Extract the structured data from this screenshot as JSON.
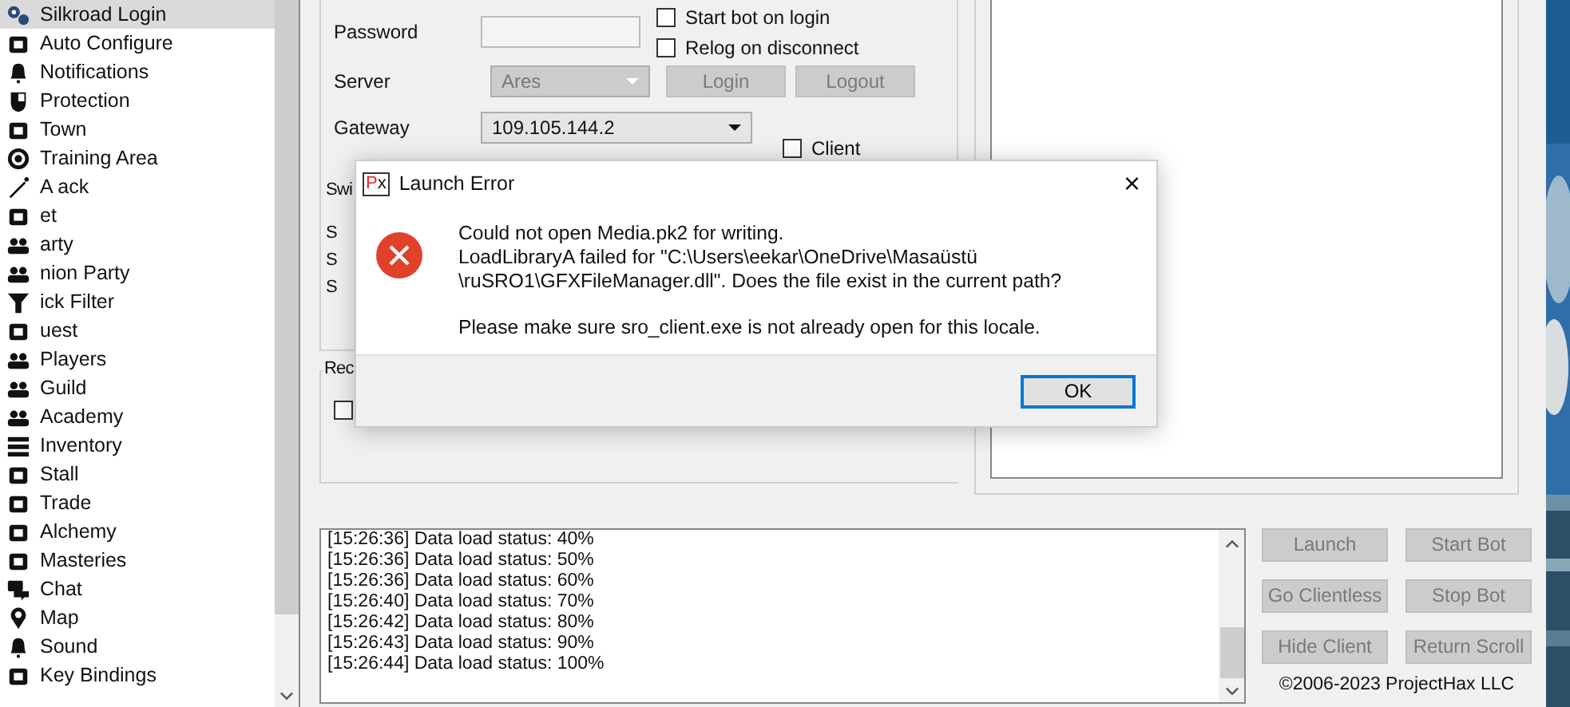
{
  "sidebar": {
    "items": [
      {
        "label": "Silkroad Login",
        "selected": true
      },
      {
        "label": "Auto Configure",
        "selected": false
      },
      {
        "label": "Notifications",
        "selected": false
      },
      {
        "label": "Protection",
        "selected": false
      },
      {
        "label": "Town",
        "selected": false
      },
      {
        "label": "Training Area",
        "selected": false
      },
      {
        "label": "A ack",
        "selected": false
      },
      {
        "label": "et",
        "selected": false
      },
      {
        "label": "arty",
        "selected": false
      },
      {
        "label": "nion Party",
        "selected": false
      },
      {
        "label": "ick Filter",
        "selected": false
      },
      {
        "label": "uest",
        "selected": false
      },
      {
        "label": "Players",
        "selected": false
      },
      {
        "label": "Guild",
        "selected": false
      },
      {
        "label": "Academy",
        "selected": false
      },
      {
        "label": "Inventory",
        "selected": false
      },
      {
        "label": "Stall",
        "selected": false
      },
      {
        "label": "Trade",
        "selected": false
      },
      {
        "label": "Alchemy",
        "selected": false
      },
      {
        "label": "Masteries",
        "selected": false
      },
      {
        "label": "Chat",
        "selected": false
      },
      {
        "label": "Map",
        "selected": false
      },
      {
        "label": "Sound",
        "selected": false
      },
      {
        "label": "Key Bindings",
        "selected": false
      }
    ]
  },
  "login": {
    "password_label": "Password",
    "server_label": "Server",
    "server": "Ares",
    "gateway_label": "Gateway",
    "gateway": "109.105.144.2",
    "checkboxes": [
      {
        "label": "Start bot on login",
        "checked": false
      },
      {
        "label": "Relog on disconnect",
        "checked": false
      }
    ],
    "buttons": [
      {
        "label": "Login",
        "disabled": true
      },
      {
        "label": "Logout",
        "disabled": true
      }
    ],
    "hidden_labels": [
      "Swi",
      "S",
      "S",
      "S"
    ],
    "client_checkbox": {
      "label": "Client",
      "checked": false
    },
    "group_label": "Rec",
    "group_checkbox": {
      "checked": false
    }
  },
  "log": [
    "[15:26:36] Data load status: 40%",
    "[15:26:36] Data load status: 50%",
    "[15:26:36] Data load status: 60%",
    "[15:26:40] Data load status: 70%",
    "[15:26:42] Data load status: 80%",
    "[15:26:43] Data load status: 90%",
    "[15:26:44] Data load status: 100%"
  ],
  "actions": [
    {
      "label": "Launch",
      "disabled": true
    },
    {
      "label": "Start Bot",
      "disabled": true
    },
    {
      "label": "Go Clientless",
      "disabled": true
    },
    {
      "label": "Stop Bot",
      "disabled": true
    },
    {
      "label": "Hide Client",
      "disabled": true
    },
    {
      "label": "Return Scroll",
      "disabled": true
    }
  ],
  "copyright": "©2006-2023 ProjectHax LLC",
  "dialog": {
    "app_icon": "Px",
    "title": "Launch Error",
    "close": "×",
    "message": [
      "Could not open Media.pk2 for writing.",
      "LoadLibraryA failed for \"C:\\Users\\eekar\\OneDrive\\Masaüstü",
      "\\ruSRO1\\GFXFileManager.dll\". Does the file exist in the current path?"
    ],
    "note": "Please make sure sro_client.exe is not already open for this locale.",
    "button": "OK"
  }
}
